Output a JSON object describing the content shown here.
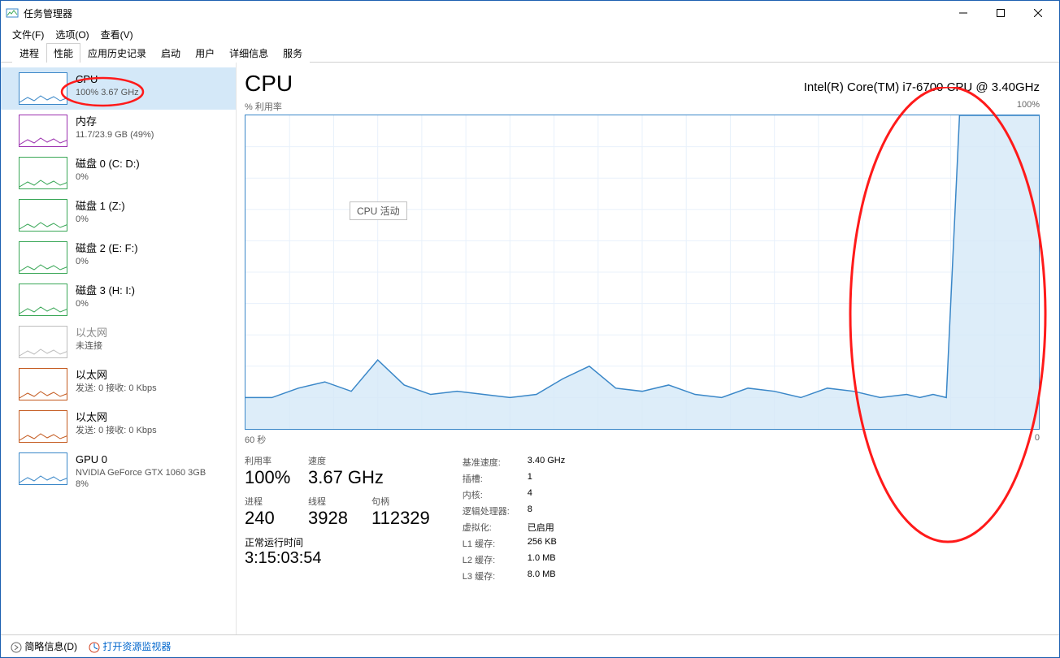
{
  "window": {
    "title": "任务管理器"
  },
  "menubar": {
    "file": "文件(F)",
    "options": "选项(O)",
    "view": "查看(V)"
  },
  "tabs": [
    "进程",
    "性能",
    "应用历史记录",
    "启动",
    "用户",
    "详细信息",
    "服务"
  ],
  "active_tab_index": 1,
  "sidebar": [
    {
      "name": "cpu",
      "title": "CPU",
      "sub": "100% 3.67 GHz",
      "selected": true,
      "color": "#3a87c8"
    },
    {
      "name": "mem",
      "title": "内存",
      "sub": "11.7/23.9 GB (49%)",
      "selected": false,
      "color": "#9b2fae"
    },
    {
      "name": "disk0",
      "title": "磁盘 0 (C: D:)",
      "sub": "0%",
      "selected": false,
      "color": "#3aa757"
    },
    {
      "name": "disk1",
      "title": "磁盘 1 (Z:)",
      "sub": "0%",
      "selected": false,
      "color": "#3aa757"
    },
    {
      "name": "disk2",
      "title": "磁盘 2 (E: F:)",
      "sub": "0%",
      "selected": false,
      "color": "#3aa757"
    },
    {
      "name": "disk3",
      "title": "磁盘 3 (H: I:)",
      "sub": "0%",
      "selected": false,
      "color": "#3aa757"
    },
    {
      "name": "eth0",
      "title": "以太网",
      "sub": "未连接",
      "selected": false,
      "color": "#bdbdbd",
      "dim": true
    },
    {
      "name": "eth1",
      "title": "以太网",
      "sub": "发送: 0 接收: 0 Kbps",
      "selected": false,
      "color": "#c45a1f"
    },
    {
      "name": "eth2",
      "title": "以太网",
      "sub": "发送: 0 接收: 0 Kbps",
      "selected": false,
      "color": "#c45a1f"
    },
    {
      "name": "gpu0",
      "title": "GPU 0",
      "sub": "NVIDIA GeForce GTX 1060 3GB",
      "sub2": "8%",
      "selected": false,
      "color": "#3a87c8"
    }
  ],
  "main": {
    "heading": "CPU",
    "model": "Intel(R) Core(TM) i7-6700 CPU @ 3.40GHz",
    "chart_top_left": "% 利用率",
    "chart_top_right": "100%",
    "chart_bottom_left": "60 秒",
    "chart_bottom_right": "0",
    "tooltip": "CPU 活动",
    "stats_big": [
      {
        "lbl": "利用率",
        "val": "100%"
      },
      {
        "lbl": "速度",
        "val": "3.67 GHz"
      }
    ],
    "stats_mid": [
      {
        "lbl": "进程",
        "val": "240"
      },
      {
        "lbl": "线程",
        "val": "3928"
      },
      {
        "lbl": "句柄",
        "val": "112329"
      }
    ],
    "uptime_lbl": "正常运行时间",
    "uptime_val": "3:15:03:54",
    "kv": [
      {
        "k": "基准速度:",
        "v": "3.40 GHz"
      },
      {
        "k": "插槽:",
        "v": "1"
      },
      {
        "k": "内核:",
        "v": "4"
      },
      {
        "k": "逻辑处理器:",
        "v": "8"
      },
      {
        "k": "虚拟化:",
        "v": "已启用"
      },
      {
        "k": "L1 缓存:",
        "v": "256 KB"
      },
      {
        "k": "L2 缓存:",
        "v": "1.0 MB"
      },
      {
        "k": "L3 缓存:",
        "v": "8.0 MB"
      }
    ]
  },
  "footer": {
    "less": "简略信息(D)",
    "resmon": "打开资源监视器"
  },
  "chart_data": {
    "type": "area",
    "title": "CPU % 利用率",
    "xlabel": "秒前",
    "ylabel": "% 利用率",
    "xlim": [
      60,
      0
    ],
    "ylim": [
      0,
      100
    ],
    "x": [
      60,
      58,
      56,
      54,
      52,
      50,
      48,
      46,
      44,
      42,
      40,
      38,
      36,
      34,
      32,
      30,
      28,
      26,
      24,
      22,
      20,
      18,
      16,
      14,
      12,
      10,
      9,
      8,
      7,
      6,
      5,
      4,
      3,
      2,
      1,
      0
    ],
    "values": [
      10,
      10,
      13,
      15,
      12,
      22,
      14,
      11,
      12,
      11,
      10,
      11,
      16,
      20,
      13,
      12,
      14,
      11,
      10,
      13,
      12,
      10,
      13,
      12,
      10,
      11,
      10,
      11,
      10,
      100,
      100,
      100,
      100,
      100,
      100,
      100
    ]
  }
}
